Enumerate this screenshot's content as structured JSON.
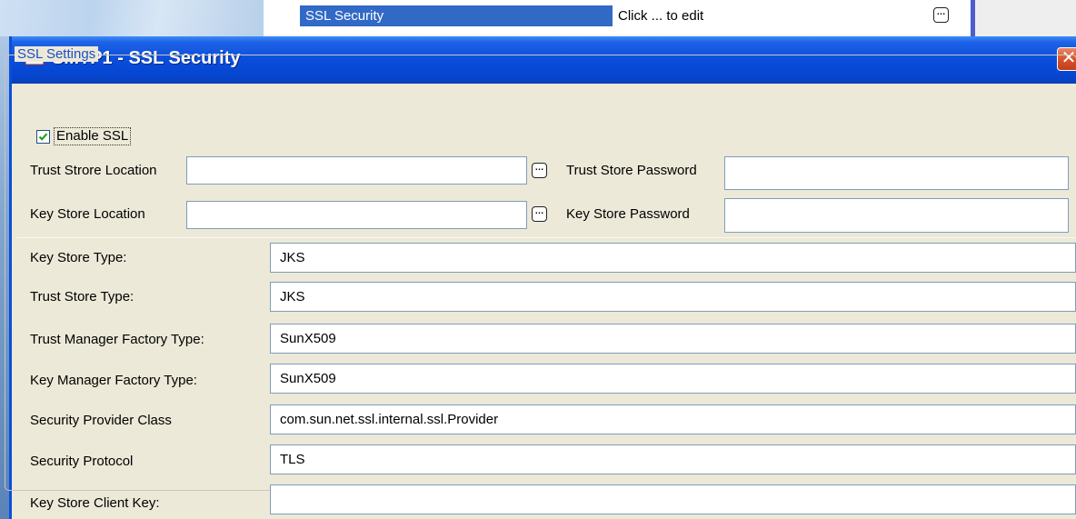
{
  "background": {
    "property_name": "SSL Security",
    "property_value": "Click ... to edit",
    "edit_button_glyph": "…"
  },
  "dialog": {
    "title": "SMTP1 - SSL Security",
    "title_icon": "mail-envelope-icon",
    "close_glyph": "✕",
    "group_title": "SSL Settings",
    "enable_ssl": {
      "label": "Enable SSL",
      "checked": true
    },
    "trust_store_location": {
      "label": "Trust Strore Location",
      "value": ""
    },
    "trust_store_password": {
      "label": "Trust Store Password",
      "value": ""
    },
    "key_store_location": {
      "label": "Key Store Location",
      "value": ""
    },
    "key_store_password": {
      "label": "Key Store Password",
      "value": ""
    },
    "browse_glyph": "…",
    "fields": [
      {
        "label": "Key Store Type:",
        "value": "JKS"
      },
      {
        "label": "Trust Store Type:",
        "value": "JKS"
      },
      {
        "label": "Trust Manager Factory Type:",
        "value": "SunX509"
      },
      {
        "label": "Key Manager Factory Type:",
        "value": "SunX509"
      },
      {
        "label": "Security Provider Class",
        "value": "com.sun.net.ssl.internal.ssl.Provider"
      },
      {
        "label": "Security Protocol",
        "value": "TLS"
      },
      {
        "label": "Key Store Client Key:",
        "value": ""
      }
    ]
  },
  "colors": {
    "titlebar": "#0a4ddb",
    "selection": "#3169c6",
    "group_title": "#1f4fc5",
    "close_button": "#d9532c"
  }
}
